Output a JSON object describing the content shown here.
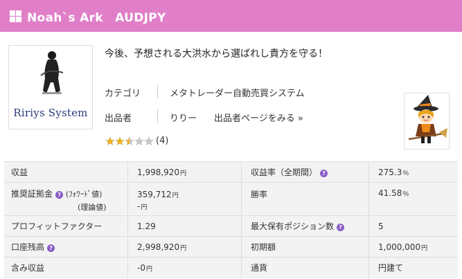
{
  "header": {
    "title": "Noah`s Ark　AUDJPY",
    "icon": "grid-icon",
    "bg_color": "#e07fc8"
  },
  "thumbnail": {
    "logo_text": "Ririys System"
  },
  "headline": "今後、予想される大洪水から選ばれし貴方を守る！",
  "meta": {
    "category_label": "カテゴリ",
    "category_value": "メタトレーダー自動売買システム",
    "seller_label": "出品者",
    "seller_name": "りりー",
    "seller_page_link": "出品者ページをみる »"
  },
  "rating": {
    "stars": 2.5,
    "max": 5,
    "count": "(4)"
  },
  "stats": {
    "profit_label": "収益",
    "profit_value": "1,998,920",
    "profit_rate_label": "収益率（全期間）",
    "profit_rate_value": "275.3",
    "percent_unit": "％",
    "yen_unit": "円",
    "margin_label": "推奨証拠金",
    "margin_forward_label": "(ﾌｫﾜｰﾄﾞ値)",
    "margin_theory_label": "(理論値)",
    "margin_forward_value": "359,712",
    "margin_theory_value": "-",
    "winrate_label": "勝率",
    "winrate_value": "41.58",
    "pf_label": "プロフィットファクター",
    "pf_value": "1.29",
    "maxpos_label": "最大保有ポジション数",
    "maxpos_value": "5",
    "balance_label": "口座残高",
    "balance_value": "2,998,920",
    "initial_label": "初期額",
    "initial_value": "1,000,000",
    "unrealized_label": "含み収益",
    "unrealized_value": "-0",
    "currency_label": "通貨",
    "currency_value": "円建て"
  }
}
